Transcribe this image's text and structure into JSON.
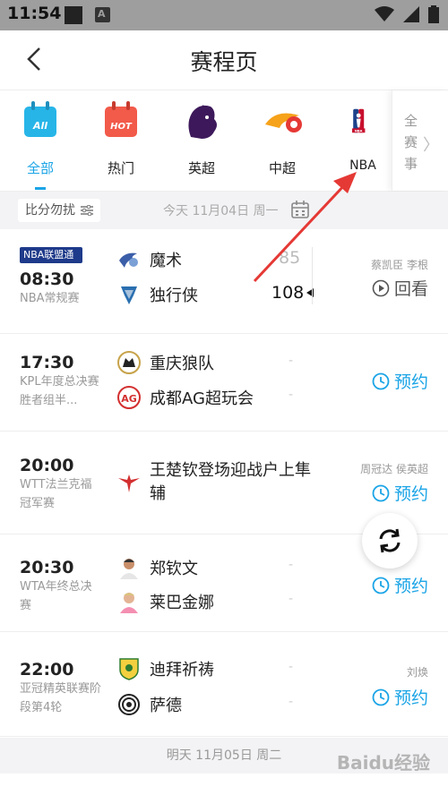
{
  "status_bar": {
    "time": "11:54",
    "notif_letter": "A"
  },
  "header": {
    "title": "赛程页"
  },
  "categories": [
    {
      "label": "全部",
      "icon": "all-calendar-icon"
    },
    {
      "label": "热门",
      "icon": "hot-calendar-icon"
    },
    {
      "label": "英超",
      "icon": "premier-league-lion-icon"
    },
    {
      "label": "中超",
      "icon": "csl-fire-ball-icon"
    },
    {
      "label": "NBA",
      "icon": "nba-logo-icon"
    }
  ],
  "all_competitions": {
    "label": "全赛事"
  },
  "filter": {
    "label": "比分勿扰"
  },
  "today_label": "今天 11月04日 周一",
  "matches": [
    {
      "badge": "NBA联盟通",
      "time": "08:30",
      "league": "NBA常规赛",
      "home": {
        "name": "魔术",
        "score": "85"
      },
      "away": {
        "name": "独行侠",
        "score": "108"
      },
      "people": "蔡凯臣 李根",
      "action": "回看"
    },
    {
      "time": "17:30",
      "league": "KPL年度总决赛胜者组半...",
      "home": {
        "name": "重庆狼队",
        "score": "-"
      },
      "away": {
        "name": "成都AG超玩会",
        "score": "-"
      },
      "action": "预约"
    },
    {
      "time": "20:00",
      "league": "WTT法兰克福冠军赛",
      "single": "王楚钦登场迎战户上隼辅",
      "people": "周冠达 侯英超",
      "action": "预约"
    },
    {
      "time": "20:30",
      "league": "WTA年终总决赛",
      "home": {
        "name": "郑钦文",
        "score": "-"
      },
      "away": {
        "name": "莱巴金娜",
        "score": "-"
      },
      "action": "预约"
    },
    {
      "time": "22:00",
      "league": "亚冠精英联赛阶段第4轮",
      "home": {
        "name": "迪拜祈祷",
        "score": "-"
      },
      "away": {
        "name": "萨德",
        "score": "-"
      },
      "people": "刘焕",
      "action": "预约"
    }
  ],
  "tomorrow_label": "明天 11月05日 周二",
  "watermark": "Baidu经验",
  "colors": {
    "accent": "#1aa4e6",
    "annotation_arrow": "#e53935",
    "status_bar": "#9e9e9e"
  }
}
